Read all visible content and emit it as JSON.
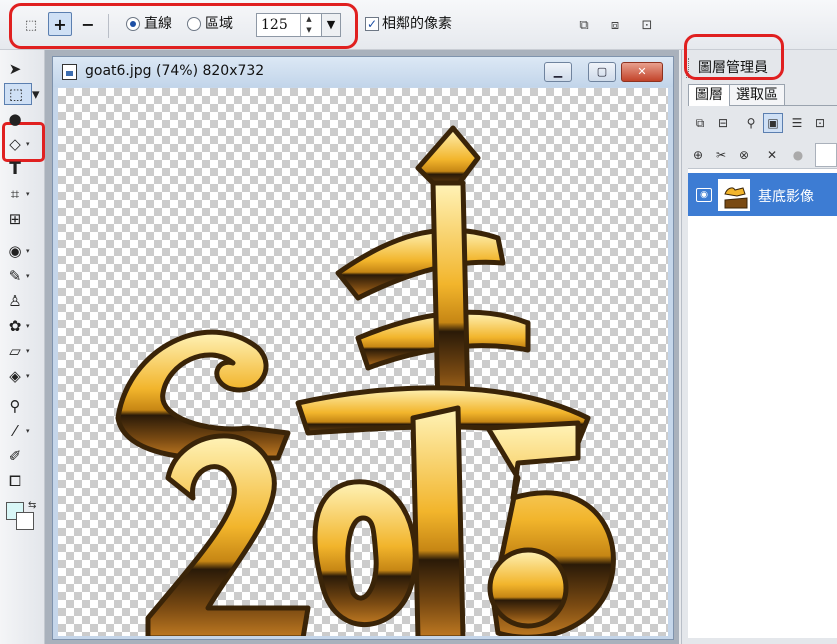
{
  "toolbar": {
    "plus_label": "+",
    "minus_label": "−",
    "mode_line_label": "直線",
    "mode_area_label": "區域",
    "tolerance_value": "125",
    "adjacent_label": "相鄰的像素",
    "adjacent_checked": true,
    "mode_selected": "直線"
  },
  "document": {
    "title": "goat6.jpg (74%) 820x732",
    "minimize_label": "▁",
    "restore_label": "▢",
    "close_label": "✕"
  },
  "panel": {
    "title": "圖層管理員",
    "tabs": [
      "圖層",
      "選取區"
    ],
    "active_tab": "圖層",
    "layers": [
      {
        "name": "基底影像",
        "visible": true
      }
    ]
  },
  "colors": {
    "accent_red": "#e02020",
    "selection_blue": "#3d7cd3",
    "gold": "#f5c02a",
    "dark_brown": "#2a1a08",
    "foreground_swatch": "#d9f7f7",
    "background_swatch": "#ffffff"
  },
  "icons": {
    "tools": [
      "arrow-pointer-icon",
      "magic-wand-select-icon",
      "sphere-icon",
      "shape-icon",
      "text-icon",
      "crop-icon",
      "straighten-icon",
      "eye-redeye-icon",
      "brush-icon",
      "stamp-icon",
      "retouch-icon",
      "eraser-icon",
      "fill-icon",
      "zoom-icon",
      "eyedropper-icon",
      "pencil-icon",
      "transform-icon"
    ]
  }
}
